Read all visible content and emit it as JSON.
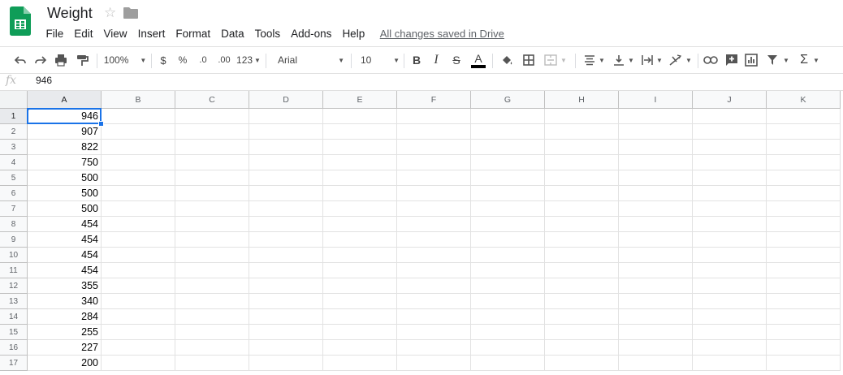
{
  "document": {
    "title": "Weight",
    "save_status": "All changes saved in Drive"
  },
  "menu": [
    "File",
    "Edit",
    "View",
    "Insert",
    "Format",
    "Data",
    "Tools",
    "Add-ons",
    "Help"
  ],
  "toolbar": {
    "zoom": "100%",
    "currency": "$",
    "percent": "%",
    "decrease_decimal": ".0",
    "increase_decimal": ".00",
    "more_formats": "123",
    "font": "Arial",
    "font_size": "10",
    "bold": "B",
    "italic": "I",
    "strike": "S",
    "text_color": "A",
    "sum": "Σ"
  },
  "formula_bar": {
    "fx": "fx",
    "value": "946"
  },
  "columns": [
    "A",
    "B",
    "C",
    "D",
    "E",
    "F",
    "G",
    "H",
    "I",
    "J",
    "K"
  ],
  "rows": [
    {
      "n": "1",
      "a": "946"
    },
    {
      "n": "2",
      "a": "907"
    },
    {
      "n": "3",
      "a": "822"
    },
    {
      "n": "4",
      "a": "750"
    },
    {
      "n": "5",
      "a": "500"
    },
    {
      "n": "6",
      "a": "500"
    },
    {
      "n": "7",
      "a": "500"
    },
    {
      "n": "8",
      "a": "454"
    },
    {
      "n": "9",
      "a": "454"
    },
    {
      "n": "10",
      "a": "454"
    },
    {
      "n": "11",
      "a": "454"
    },
    {
      "n": "12",
      "a": "355"
    },
    {
      "n": "13",
      "a": "340"
    },
    {
      "n": "14",
      "a": "284"
    },
    {
      "n": "15",
      "a": "255"
    },
    {
      "n": "16",
      "a": "227"
    },
    {
      "n": "17",
      "a": "200"
    }
  ],
  "colors": {
    "accent": "#1a73e8",
    "sheets_green": "#0f9d58"
  }
}
